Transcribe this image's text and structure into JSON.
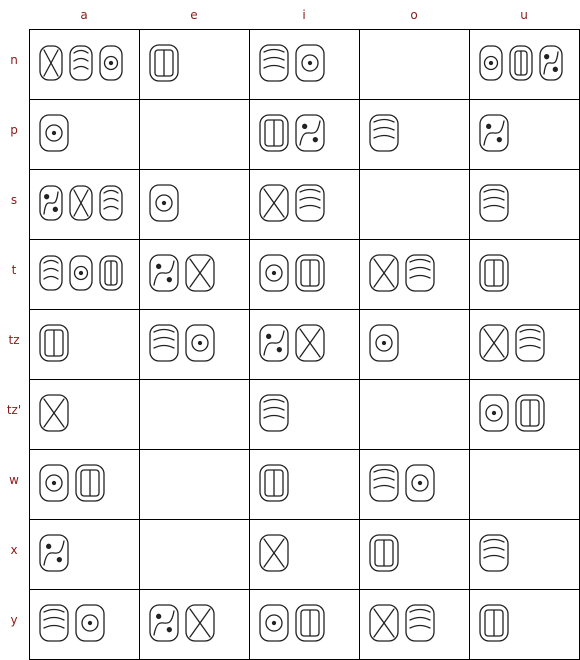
{
  "vowels": [
    "a",
    "e",
    "i",
    "o",
    "u"
  ],
  "consonants": [
    "n",
    "p",
    "s",
    "t",
    "tz",
    "tz'",
    "w",
    "x",
    "y"
  ],
  "cells": [
    [
      "n-a",
      "n-e",
      "n-i",
      "",
      "n-u"
    ],
    [
      "p-a",
      "",
      "p-i",
      "p-o",
      "p-u"
    ],
    [
      "s-a",
      "s-e",
      "s-i",
      "",
      "s-u"
    ],
    [
      "t-a",
      "t-e",
      "t-i",
      "t-o",
      "t-u"
    ],
    [
      "tz-a",
      "tz-e",
      "tz-i",
      "tz-o",
      "tz-u"
    ],
    [
      "tz'-a",
      "",
      "tz'-i",
      "",
      "tz'-u"
    ],
    [
      "w-a",
      "",
      "w-i",
      "w-o",
      ""
    ],
    [
      "x-a",
      "",
      "x-i",
      "x-o",
      "x-u"
    ],
    [
      "y-a",
      "y-e",
      "y-i",
      "y-o",
      "y-u"
    ]
  ],
  "glyph_counts": [
    [
      3,
      1,
      2,
      0,
      3
    ],
    [
      1,
      0,
      2,
      1,
      1
    ],
    [
      3,
      1,
      2,
      0,
      1
    ],
    [
      3,
      2,
      2,
      2,
      1
    ],
    [
      1,
      2,
      2,
      1,
      2
    ],
    [
      1,
      0,
      1,
      0,
      2
    ],
    [
      2,
      0,
      1,
      2,
      0
    ],
    [
      1,
      0,
      1,
      1,
      1
    ],
    [
      2,
      2,
      2,
      2,
      1
    ]
  ],
  "colors": {
    "header_text": "#8b1a1a",
    "grid": "#000000",
    "glyph_stroke": "#222222"
  }
}
